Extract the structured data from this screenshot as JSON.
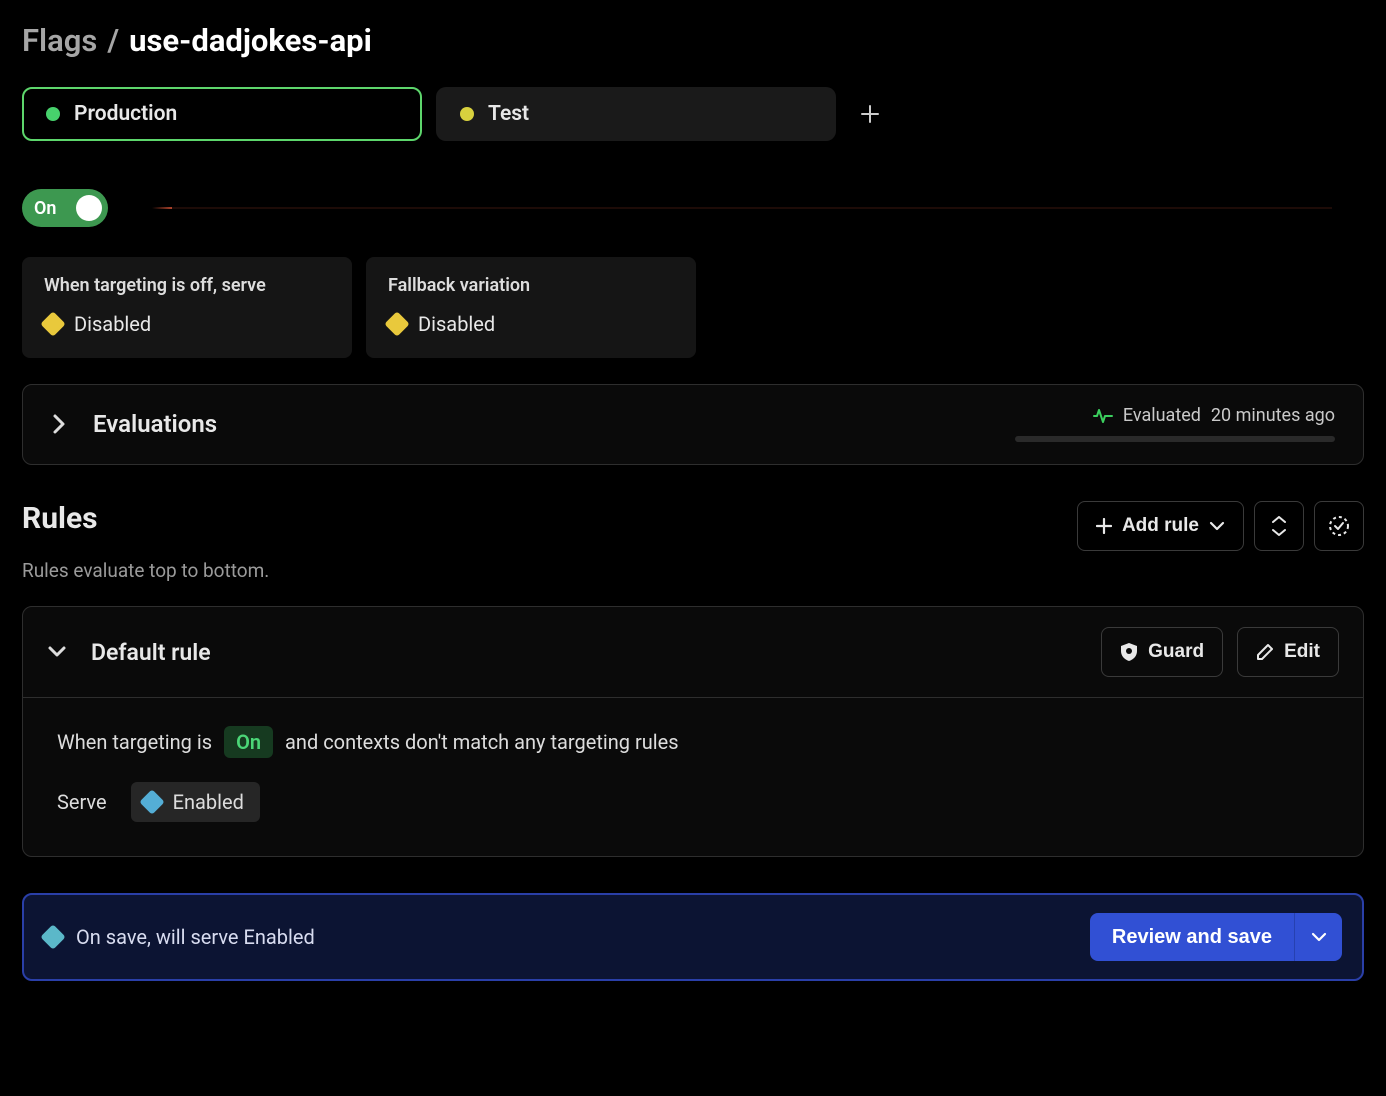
{
  "breadcrumb": {
    "parent": "Flags",
    "sep": "/",
    "current": "use-dadjokes-api"
  },
  "environments": {
    "tabs": [
      {
        "label": "Production",
        "color": "green",
        "active": true
      },
      {
        "label": "Test",
        "color": "yellow",
        "active": false
      }
    ]
  },
  "toggle": {
    "label": "On",
    "state": "on"
  },
  "variation_cards": [
    {
      "title": "When targeting is off, serve",
      "variation": "Disabled",
      "diamond": "yellow"
    },
    {
      "title": "Fallback variation",
      "variation": "Disabled",
      "diamond": "yellow"
    }
  ],
  "evaluations": {
    "title": "Evaluations",
    "status_prefix": "Evaluated",
    "status_time": "20 minutes ago"
  },
  "rules": {
    "title": "Rules",
    "subtitle": "Rules evaluate top to bottom.",
    "add_label": "Add rule",
    "default_rule": {
      "name": "Default rule",
      "guard_label": "Guard",
      "edit_label": "Edit",
      "line_prefix": "When targeting is",
      "line_state": "On",
      "line_suffix": "and contexts don't match any targeting rules",
      "serve_label": "Serve",
      "serve_variation": "Enabled"
    }
  },
  "save_bar": {
    "message": "On save, will serve Enabled",
    "button": "Review and save"
  }
}
